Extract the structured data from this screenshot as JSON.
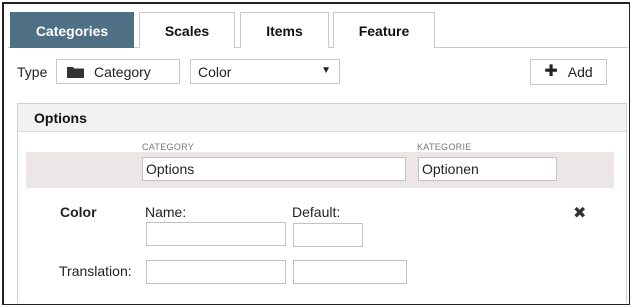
{
  "tabs": [
    {
      "label": "Categories",
      "active": true
    },
    {
      "label": "Scales",
      "active": false
    },
    {
      "label": "Items",
      "active": false
    },
    {
      "label": "Feature",
      "active": false
    }
  ],
  "type_row": {
    "type_label": "Type",
    "type_value": "Category",
    "type_icon": "folder-icon",
    "color_select_value": "Color",
    "add_label": "Add",
    "add_icon": "plus-icon"
  },
  "options_panel": {
    "title": "Options",
    "category_col_label": "CATEGORY",
    "kategorie_col_label": "KATEGORIE",
    "category_value": "Options",
    "kategorie_value": "Optionen"
  },
  "color_block": {
    "title": "Color",
    "name_label": "Name:",
    "default_label": "Default:",
    "translation_label": "Translation:",
    "name_value": "",
    "default_value": "",
    "translation_value_1": "",
    "translation_value_2": "",
    "remove_icon": "close-icon"
  },
  "colors": {
    "accent": "#4f6f85",
    "row_highlight": "#ece6e6"
  }
}
